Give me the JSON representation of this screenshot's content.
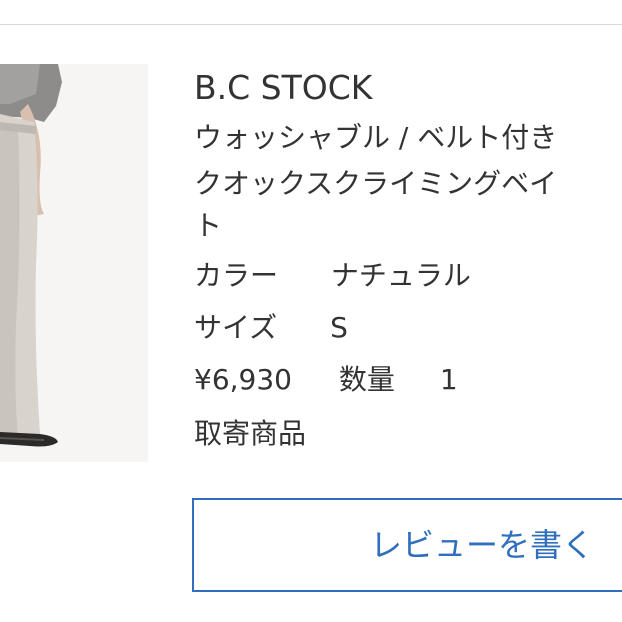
{
  "order_item": {
    "brand": "B.C STOCK",
    "title_lines": [
      "ウォッシャブル / ベルト付き",
      "クオックスクライミングベイ",
      "ト"
    ],
    "color_label": "カラー",
    "color_value": "ナチュラル",
    "size_label": "サイズ",
    "size_value": "S",
    "price": "¥6,930",
    "quantity_label": "数量",
    "quantity_value": "1",
    "status": "取寄商品",
    "review_button_label": "レビューを書く",
    "colors": {
      "text": "#333333",
      "accent": "#2f6fbd",
      "divider": "#d9d9d9"
    }
  }
}
